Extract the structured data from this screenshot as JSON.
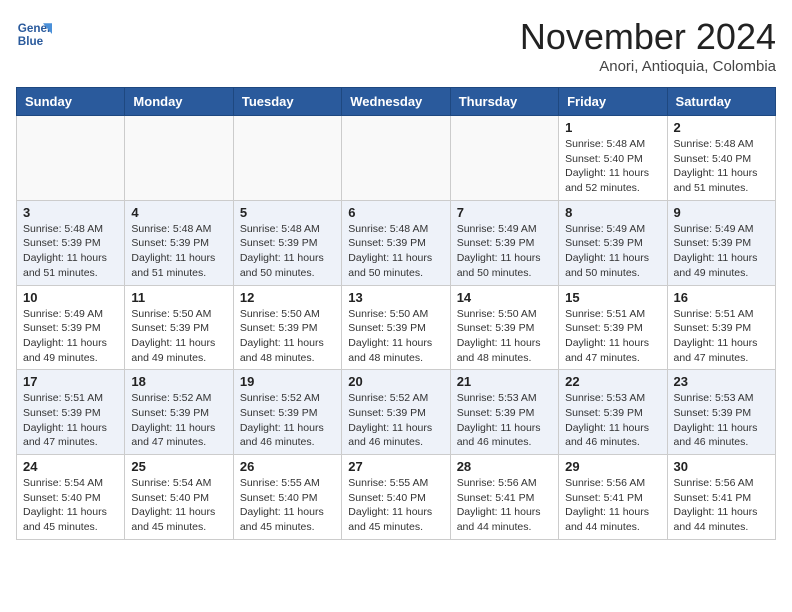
{
  "header": {
    "logo_line1": "General",
    "logo_line2": "Blue",
    "month": "November 2024",
    "location": "Anori, Antioquia, Colombia"
  },
  "weekdays": [
    "Sunday",
    "Monday",
    "Tuesday",
    "Wednesday",
    "Thursday",
    "Friday",
    "Saturday"
  ],
  "weeks": [
    [
      {
        "day": "",
        "info": ""
      },
      {
        "day": "",
        "info": ""
      },
      {
        "day": "",
        "info": ""
      },
      {
        "day": "",
        "info": ""
      },
      {
        "day": "",
        "info": ""
      },
      {
        "day": "1",
        "info": "Sunrise: 5:48 AM\nSunset: 5:40 PM\nDaylight: 11 hours\nand 52 minutes."
      },
      {
        "day": "2",
        "info": "Sunrise: 5:48 AM\nSunset: 5:40 PM\nDaylight: 11 hours\nand 51 minutes."
      }
    ],
    [
      {
        "day": "3",
        "info": "Sunrise: 5:48 AM\nSunset: 5:39 PM\nDaylight: 11 hours\nand 51 minutes."
      },
      {
        "day": "4",
        "info": "Sunrise: 5:48 AM\nSunset: 5:39 PM\nDaylight: 11 hours\nand 51 minutes."
      },
      {
        "day": "5",
        "info": "Sunrise: 5:48 AM\nSunset: 5:39 PM\nDaylight: 11 hours\nand 50 minutes."
      },
      {
        "day": "6",
        "info": "Sunrise: 5:48 AM\nSunset: 5:39 PM\nDaylight: 11 hours\nand 50 minutes."
      },
      {
        "day": "7",
        "info": "Sunrise: 5:49 AM\nSunset: 5:39 PM\nDaylight: 11 hours\nand 50 minutes."
      },
      {
        "day": "8",
        "info": "Sunrise: 5:49 AM\nSunset: 5:39 PM\nDaylight: 11 hours\nand 50 minutes."
      },
      {
        "day": "9",
        "info": "Sunrise: 5:49 AM\nSunset: 5:39 PM\nDaylight: 11 hours\nand 49 minutes."
      }
    ],
    [
      {
        "day": "10",
        "info": "Sunrise: 5:49 AM\nSunset: 5:39 PM\nDaylight: 11 hours\nand 49 minutes."
      },
      {
        "day": "11",
        "info": "Sunrise: 5:50 AM\nSunset: 5:39 PM\nDaylight: 11 hours\nand 49 minutes."
      },
      {
        "day": "12",
        "info": "Sunrise: 5:50 AM\nSunset: 5:39 PM\nDaylight: 11 hours\nand 48 minutes."
      },
      {
        "day": "13",
        "info": "Sunrise: 5:50 AM\nSunset: 5:39 PM\nDaylight: 11 hours\nand 48 minutes."
      },
      {
        "day": "14",
        "info": "Sunrise: 5:50 AM\nSunset: 5:39 PM\nDaylight: 11 hours\nand 48 minutes."
      },
      {
        "day": "15",
        "info": "Sunrise: 5:51 AM\nSunset: 5:39 PM\nDaylight: 11 hours\nand 47 minutes."
      },
      {
        "day": "16",
        "info": "Sunrise: 5:51 AM\nSunset: 5:39 PM\nDaylight: 11 hours\nand 47 minutes."
      }
    ],
    [
      {
        "day": "17",
        "info": "Sunrise: 5:51 AM\nSunset: 5:39 PM\nDaylight: 11 hours\nand 47 minutes."
      },
      {
        "day": "18",
        "info": "Sunrise: 5:52 AM\nSunset: 5:39 PM\nDaylight: 11 hours\nand 47 minutes."
      },
      {
        "day": "19",
        "info": "Sunrise: 5:52 AM\nSunset: 5:39 PM\nDaylight: 11 hours\nand 46 minutes."
      },
      {
        "day": "20",
        "info": "Sunrise: 5:52 AM\nSunset: 5:39 PM\nDaylight: 11 hours\nand 46 minutes."
      },
      {
        "day": "21",
        "info": "Sunrise: 5:53 AM\nSunset: 5:39 PM\nDaylight: 11 hours\nand 46 minutes."
      },
      {
        "day": "22",
        "info": "Sunrise: 5:53 AM\nSunset: 5:39 PM\nDaylight: 11 hours\nand 46 minutes."
      },
      {
        "day": "23",
        "info": "Sunrise: 5:53 AM\nSunset: 5:39 PM\nDaylight: 11 hours\nand 46 minutes."
      }
    ],
    [
      {
        "day": "24",
        "info": "Sunrise: 5:54 AM\nSunset: 5:40 PM\nDaylight: 11 hours\nand 45 minutes."
      },
      {
        "day": "25",
        "info": "Sunrise: 5:54 AM\nSunset: 5:40 PM\nDaylight: 11 hours\nand 45 minutes."
      },
      {
        "day": "26",
        "info": "Sunrise: 5:55 AM\nSunset: 5:40 PM\nDaylight: 11 hours\nand 45 minutes."
      },
      {
        "day": "27",
        "info": "Sunrise: 5:55 AM\nSunset: 5:40 PM\nDaylight: 11 hours\nand 45 minutes."
      },
      {
        "day": "28",
        "info": "Sunrise: 5:56 AM\nSunset: 5:41 PM\nDaylight: 11 hours\nand 44 minutes."
      },
      {
        "day": "29",
        "info": "Sunrise: 5:56 AM\nSunset: 5:41 PM\nDaylight: 11 hours\nand 44 minutes."
      },
      {
        "day": "30",
        "info": "Sunrise: 5:56 AM\nSunset: 5:41 PM\nDaylight: 11 hours\nand 44 minutes."
      }
    ]
  ]
}
